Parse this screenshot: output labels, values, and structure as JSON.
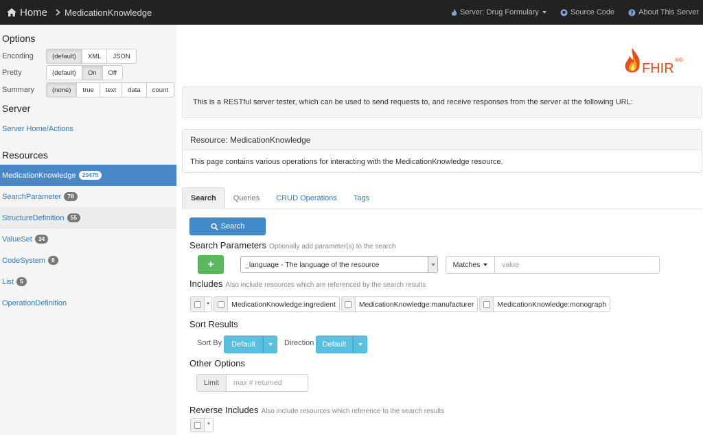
{
  "navbar": {
    "home_label": "Home",
    "breadcrumb": "MedicationKnowledge",
    "server_label": "Server: Drug Formulary",
    "source_label": "Source Code",
    "about_label": "About This Server"
  },
  "sidebar": {
    "options_heading": "Options",
    "encoding": {
      "label": "Encoding",
      "options": [
        "(default)",
        "XML",
        "JSON"
      ],
      "active": "(default)"
    },
    "pretty": {
      "label": "Pretty",
      "options": [
        "(default)",
        "On",
        "Off"
      ],
      "active": "On"
    },
    "summary": {
      "label": "Summary",
      "options": [
        "(none)",
        "true",
        "text",
        "data",
        "count"
      ],
      "active": "(none)"
    },
    "server_heading": "Server",
    "server_link": "Server Home/Actions",
    "resources_heading": "Resources",
    "resources": [
      {
        "name": "MedicationKnowledge",
        "count": "20475",
        "active": true
      },
      {
        "name": "SearchParameter",
        "count": "78"
      },
      {
        "name": "StructureDefinition",
        "count": "55"
      },
      {
        "name": "ValueSet",
        "count": "34"
      },
      {
        "name": "CodeSystem",
        "count": "8"
      },
      {
        "name": "List",
        "count": "5"
      },
      {
        "name": "OperationDefinition",
        "count": ""
      }
    ]
  },
  "main": {
    "logo_text": "FHIR",
    "logo_mark": "®©",
    "intro": "This is a RESTful server tester, which can be used to send requests to, and receive responses from the server at the following URL:",
    "panel_title": "Resource: MedicationKnowledge",
    "panel_body": "This page contains various operations for interacting with the MedicationKnowledge resource.",
    "tabs": [
      "Search",
      "Queries",
      "CRUD Operations",
      "Tags"
    ],
    "search_button": "Search",
    "search_params": {
      "heading": "Search Parameters",
      "hint": "Optionally add parameter(s) to the search"
    },
    "param_select": "_language - The language of the resource",
    "matches_label": "Matches",
    "value_placeholder": "value",
    "includes": {
      "heading": "Includes",
      "hint": "Also include resources which are referenced by the search results"
    },
    "include_items": [
      "*",
      "MedicationKnowledge:ingredient",
      "MedicationKnowledge:manufacturer",
      "MedicationKnowledge:monograph"
    ],
    "sort": {
      "heading": "Sort Results",
      "sort_by_label": "Sort By",
      "sort_by_value": "Default",
      "direction_label": "Direction",
      "direction_value": "Default"
    },
    "other": {
      "heading": "Other Options",
      "limit_label": "Limit",
      "limit_placeholder": "max # returned"
    },
    "rev_includes": {
      "heading": "Reverse Includes",
      "hint": "Also include resources which reference to the search results",
      "item": "*"
    }
  },
  "colors": {
    "navbar": "#222222",
    "primary": "#428bca",
    "success": "#5cb85c",
    "info": "#5bc0de",
    "active_row": "#4a87c7"
  }
}
